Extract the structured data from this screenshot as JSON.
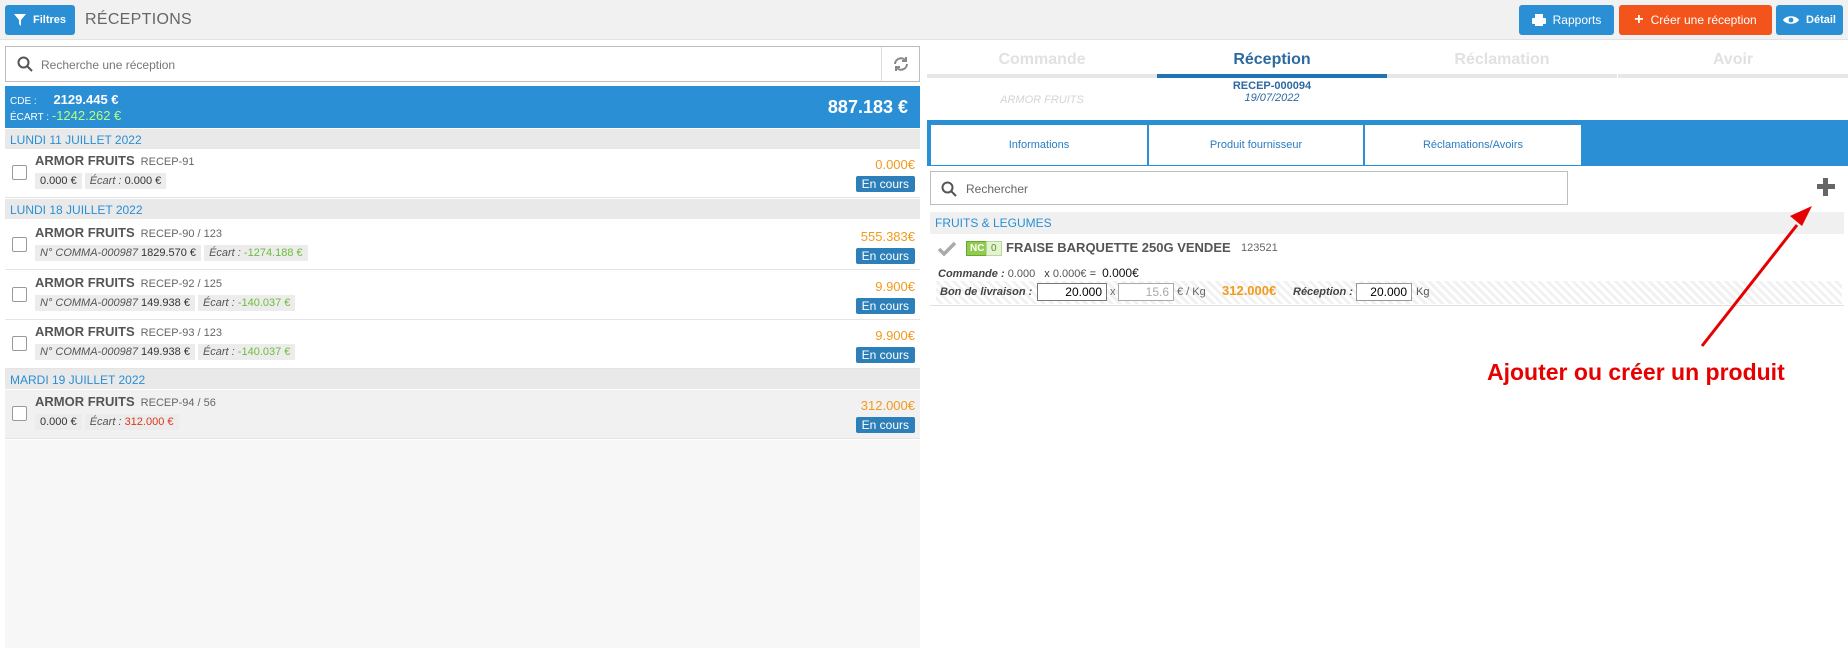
{
  "header": {
    "filters_label": "Filtres",
    "page_title": "RÉCEPTIONS",
    "reports_label": "Rapports",
    "create_label": "Créer une réception",
    "detail_label": "Détail"
  },
  "list": {
    "search_placeholder": "Recherche une réception",
    "summary": {
      "cde_label": "CDE :",
      "cde_value": "2129.445 €",
      "ecart_label": "ÉCART :",
      "ecart_value": "-1242.262 €",
      "total": "887.183 €"
    },
    "groups": [
      {
        "date": "LUNDI 11 JUILLET 2022"
      },
      {
        "date": "LUNDI 18 JUILLET 2022"
      },
      {
        "date": "MARDI 19 JUILLET 2022"
      }
    ],
    "rows": [
      {
        "supplier": "ARMOR FRUITS",
        "ref": "RECEP-91",
        "order": "",
        "order_amount": "0.000 €",
        "ecart_label": "Écart :",
        "ecart": "0.000 €",
        "amount": "0.000€",
        "status": "En cours"
      },
      {
        "supplier": "ARMOR FRUITS",
        "ref": "RECEP-90 / 123",
        "order": "N° COMMA-000987",
        "order_amount": "1829.570 €",
        "ecart_label": "Écart :",
        "ecart": "-1274.188 €",
        "amount": "555.383€",
        "status": "En cours"
      },
      {
        "supplier": "ARMOR FRUITS",
        "ref": "RECEP-92 / 125",
        "order": "N° COMMA-000987",
        "order_amount": "149.938 €",
        "ecart_label": "Écart :",
        "ecart": "-140.037 €",
        "amount": "9.900€",
        "status": "En cours"
      },
      {
        "supplier": "ARMOR FRUITS",
        "ref": "RECEP-93 / 123",
        "order": "N° COMMA-000987",
        "order_amount": "149.938 €",
        "ecart_label": "Écart :",
        "ecart": "-140.037 €",
        "amount": "9.900€",
        "status": "En cours"
      },
      {
        "supplier": "ARMOR FRUITS",
        "ref": "RECEP-94 / 56",
        "order": "",
        "order_amount": "0.000 €",
        "ecart_label": "Écart :",
        "ecart": "312.000 €",
        "amount": "312.000€",
        "status": "En cours"
      }
    ]
  },
  "detail": {
    "tabs": [
      "Commande",
      "Réception",
      "Réclamation",
      "Avoir"
    ],
    "commande_sub": "ARMOR FRUITS",
    "reception_ref": "RECEP-000094",
    "reception_date": "19/07/2022",
    "subtabs": [
      "Informations",
      "Produit fournisseur",
      "Réclamations/Avoirs"
    ],
    "search_placeholder": "Rechercher",
    "category": "FRUITS & LEGUMES",
    "product": {
      "nc": "NC",
      "count": "0",
      "name": "FRAISE BARQUETTE 250G VENDEE",
      "code": "123521",
      "commande_label": "Commande :",
      "commande_qty": "0.000",
      "times": "x",
      "commande_price": "0.000€",
      "equals": "=",
      "commande_total": "0.000€",
      "bl_label": "Bon de livraison :",
      "bl_qty": "20.000",
      "bl_price": "15.6",
      "bl_unit": "€ / Kg",
      "bl_total": "312.000€",
      "reception_label": "Réception :",
      "reception_qty": "20.000",
      "reception_unit": "Kg"
    }
  },
  "annotation": "Ajouter ou créer un produit",
  "colors": {
    "primary": "#2a8fd4",
    "orange": "#f2541c",
    "amount": "#f29a1e",
    "arrow": "#e60000"
  }
}
